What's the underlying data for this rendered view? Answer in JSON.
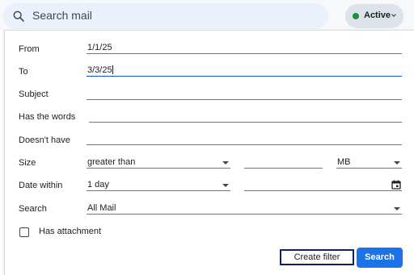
{
  "search": {
    "placeholder": "Search mail"
  },
  "status": {
    "label": "Active",
    "color": "#1e8e3e"
  },
  "form": {
    "from_label": "From",
    "from_value": "1/1/25",
    "to_label": "To",
    "to_value": "3/3/25",
    "subject_label": "Subject",
    "subject_value": "",
    "has_words_label": "Has the words",
    "has_words_value": "",
    "doesnt_have_label": "Doesn't have",
    "doesnt_have_value": "",
    "size_label": "Size",
    "size_operator": "greater than",
    "size_value": "",
    "size_unit": "MB",
    "date_within_label": "Date within",
    "date_within_value": "1 day",
    "date_value": "",
    "search_label": "Search",
    "search_scope": "All Mail",
    "has_attachment_label": "Has attachment",
    "has_attachment_checked": false
  },
  "actions": {
    "create_filter": "Create filter",
    "search": "Search"
  },
  "colors": {
    "accent": "#1a73e8",
    "focus": "#0b57d0"
  }
}
